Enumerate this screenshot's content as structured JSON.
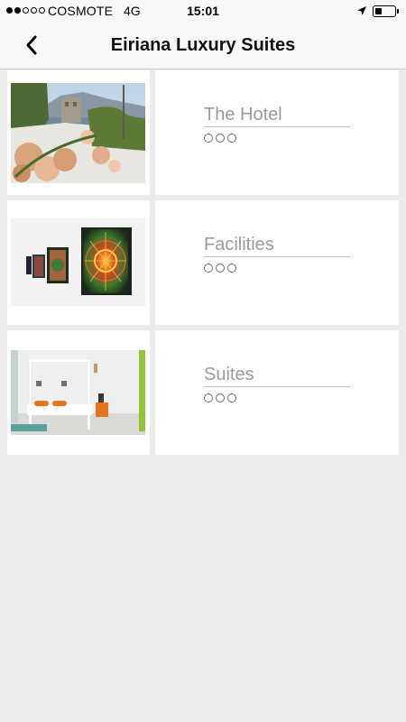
{
  "status_bar": {
    "carrier": "COSMOTE",
    "network": "4G",
    "time": "15:01",
    "signal_strength": 2,
    "battery_level": 0.35
  },
  "nav": {
    "title": "Eiriana Luxury Suites",
    "back_icon": "chevron-left-icon"
  },
  "menu_items": [
    {
      "label": "The Hotel",
      "image": "hotel-thumbnail",
      "more_icon": "more-dots-icon"
    },
    {
      "label": "Facilities",
      "image": "facilities-thumbnail",
      "more_icon": "more-dots-icon"
    },
    {
      "label": "Suites",
      "image": "suites-thumbnail",
      "more_icon": "more-dots-icon"
    }
  ],
  "colors": {
    "background": "#ebebeb",
    "bar": "#f7f7f7",
    "label": "#9a9a9a"
  }
}
